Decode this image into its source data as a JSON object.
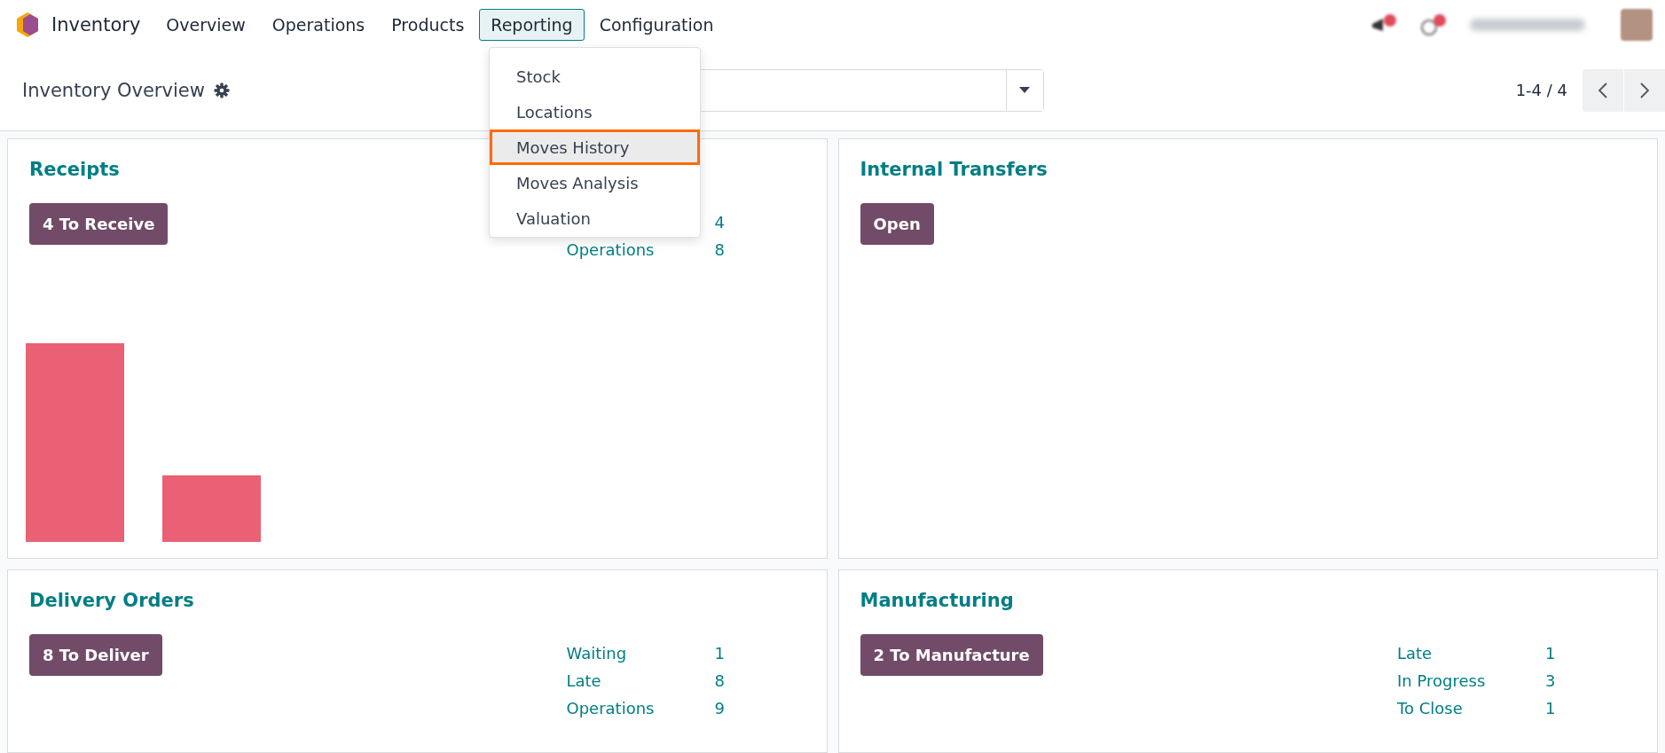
{
  "app": {
    "name": "Inventory"
  },
  "nav": [
    {
      "label": "Overview",
      "selected": false
    },
    {
      "label": "Operations",
      "selected": false
    },
    {
      "label": "Products",
      "selected": false
    },
    {
      "label": "Reporting",
      "selected": true
    },
    {
      "label": "Configuration",
      "selected": false
    }
  ],
  "reporting_menu": [
    {
      "label": "Stock",
      "selected": false
    },
    {
      "label": "Locations",
      "selected": false
    },
    {
      "label": "Moves History",
      "selected": true
    },
    {
      "label": "Moves Analysis",
      "selected": false
    },
    {
      "label": "Valuation",
      "selected": false
    }
  ],
  "control_panel": {
    "title": "Inventory Overview",
    "pager": "1-4 / 4"
  },
  "cards": [
    {
      "title": "Receipts",
      "button": "4 To Receive",
      "kind": "chart",
      "stats": [
        {
          "value": "4"
        },
        {
          "label": "Operations",
          "value": "8"
        }
      ]
    },
    {
      "title": "Internal Transfers",
      "button": "Open",
      "kind": "plain"
    },
    {
      "title": "Delivery Orders",
      "button": "8 To Deliver",
      "kind": "plain",
      "stats": [
        {
          "label": "Waiting",
          "value": "1"
        },
        {
          "label": "Late",
          "value": "8"
        },
        {
          "label": "Operations",
          "value": "9"
        }
      ]
    },
    {
      "title": "Manufacturing",
      "button": "2 To Manufacture",
      "kind": "plain",
      "stats": [
        {
          "label": "Late",
          "value": "1"
        },
        {
          "label": "In Progress",
          "value": "3"
        },
        {
          "label": "To Close",
          "value": "1"
        }
      ]
    }
  ]
}
